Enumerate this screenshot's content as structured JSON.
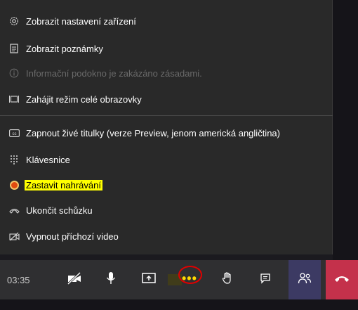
{
  "menu": {
    "items": [
      {
        "icon": "gear-icon",
        "label": "Zobrazit nastavení zařízení"
      },
      {
        "icon": "notes-icon",
        "label": "Zobrazit poznámky"
      },
      {
        "icon": "info-icon",
        "label": "Informační podokno je zakázáno zásadami."
      },
      {
        "icon": "fullscreen-icon",
        "label": "Zahájit režim celé obrazovky"
      },
      {
        "icon": "captions-icon",
        "label": "Zapnout živé titulky (verze Preview, jenom americká angličtina)"
      },
      {
        "icon": "keypad-icon",
        "label": "Klávesnice"
      },
      {
        "icon": "record-stop-icon",
        "label": "Zastavit nahrávání"
      },
      {
        "icon": "end-meeting-icon",
        "label": "Ukončit schůzku"
      },
      {
        "icon": "video-off-icon",
        "label": "Vypnout příchozí video"
      }
    ]
  },
  "toolbar": {
    "time": "03:35",
    "more_label": "•••"
  },
  "colors": {
    "menu_bg": "#292929",
    "highlight": "#ffff00",
    "hangup": "#c4314b",
    "people_bg": "#3c3a63",
    "annotation_circle": "#e00000"
  }
}
